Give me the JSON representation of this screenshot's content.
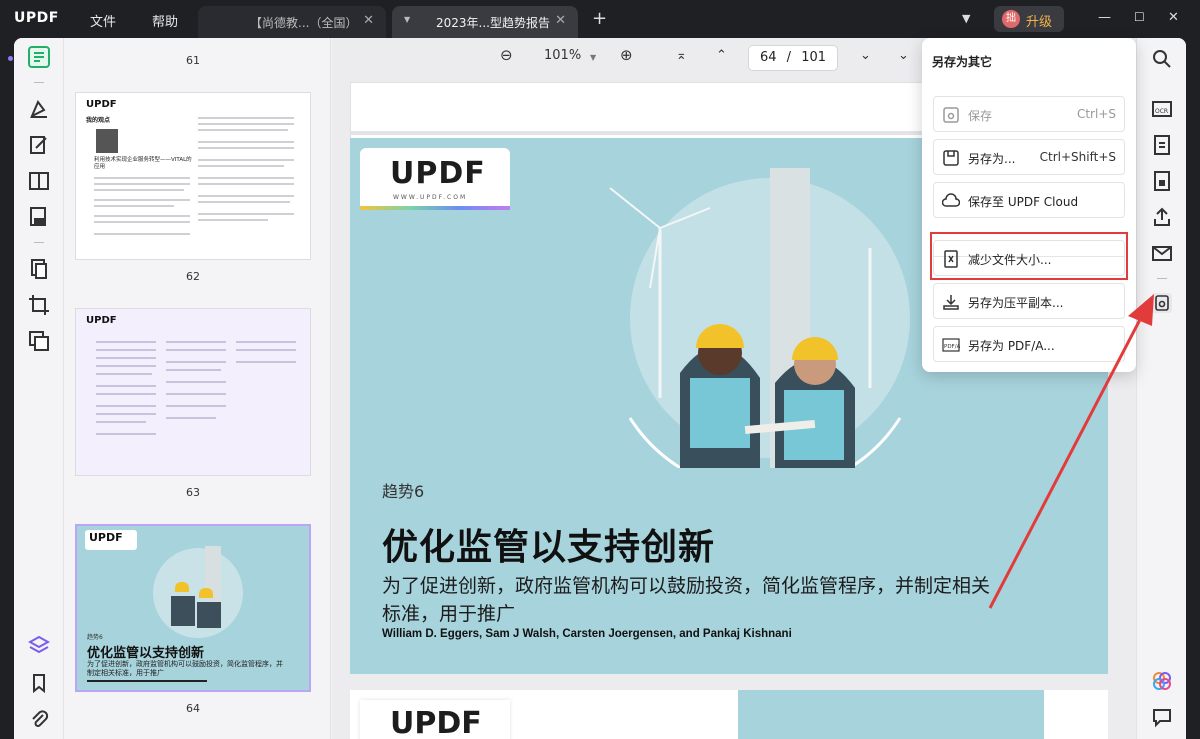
{
  "app": {
    "logo": "UPDF",
    "menu": [
      "文件",
      "帮助"
    ],
    "tabs": [
      {
        "title": "【尚德教...（全国）",
        "active": false
      },
      {
        "title": "2023年...型趋势报告",
        "active": true
      }
    ],
    "new_tab": "+",
    "avatar": "拙",
    "upgrade_label": "升级"
  },
  "toolbar": {
    "zoom": "101%",
    "current_page": "64",
    "separator": "/",
    "total_pages": "101"
  },
  "thumbnails": {
    "labels": [
      "61",
      "62",
      "63",
      "64"
    ],
    "selected": "64",
    "thumb62": {
      "section": "我的观点",
      "heading": "利用技术实现企业服务转型——VITAL的应用"
    },
    "thumb64": {
      "logo": "UPDF",
      "trend": "趋势6",
      "title": "优化监管以支持创新",
      "sub": "为了促进创新，政府监管机构可以鼓励投资，简化监管程序，并制定相关标准，用于推广"
    }
  },
  "slide": {
    "logo": "UPDF",
    "logo_url": "WWW.UPDF.COM",
    "trend": "趋势6",
    "headline": "优化监管以支持创新",
    "subtitle": "为了促进创新，政府监管机构可以鼓励投资，简化监管程序，并制定相关标准，用于推广",
    "authors": "William D. Eggers, Sam J Walsh, Carsten Joergensen, and Pankaj Kishnani"
  },
  "next_page": {
    "logo": "UPDF"
  },
  "save_menu": {
    "title": "另存为其它",
    "items": [
      {
        "label": "保存",
        "shortcut": "Ctrl+S",
        "icon": "save-icon",
        "disabled": true
      },
      {
        "label": "另存为...",
        "shortcut": "Ctrl+Shift+S",
        "icon": "save-as-icon",
        "disabled": false
      },
      {
        "label": "保存至 UPDF Cloud",
        "shortcut": "",
        "icon": "cloud-icon",
        "disabled": false
      },
      {
        "label": "减少文件大小...",
        "shortcut": "",
        "icon": "compress-icon",
        "disabled": false
      },
      {
        "label": "另存为压平副本...",
        "shortcut": "",
        "icon": "flatten-icon",
        "disabled": false
      },
      {
        "label": "另存为 PDF/A...",
        "shortcut": "",
        "icon": "pdfa-icon",
        "disabled": false
      }
    ]
  },
  "colors": {
    "accent": "#7b5cf0",
    "annotation": "#e23b3b",
    "slide_bg": "#a7d3dc",
    "upgrade": "#f1b24c"
  }
}
